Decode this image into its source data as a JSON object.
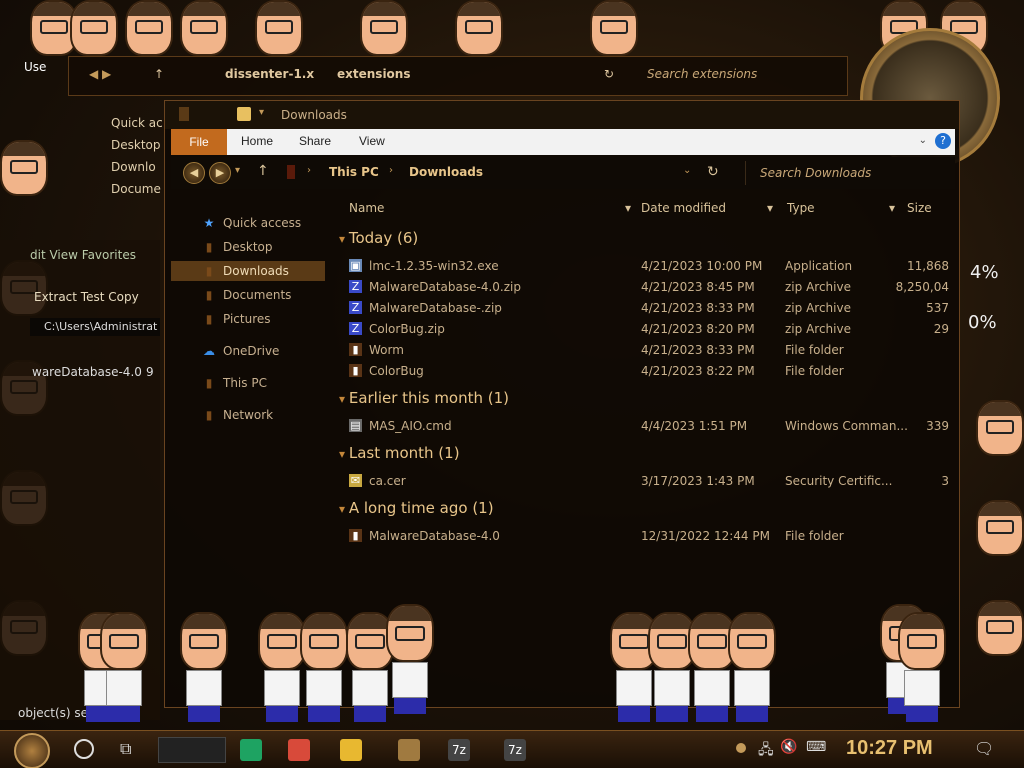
{
  "bg_window": {
    "crumb1": "dissenter-1.x",
    "crumb2": "extensions",
    "search_placeholder": "Search extensions",
    "sidebar": [
      "Quick ac",
      "Desktop",
      "Downlo",
      "Docume"
    ]
  },
  "left_pane": {
    "menu": "dit   View   Favorites",
    "toolbar": "Extract  Test   Copy",
    "address": "C:\\Users\\Administrat",
    "row": "wareDatabase-4.0",
    "row_extra": "9",
    "status": "object(s) sele"
  },
  "overlay_text": {
    "user": "Use",
    "pct1": "4%",
    "pct2": "0%"
  },
  "window": {
    "title": "Downloads",
    "ribbon": {
      "file": "File",
      "home": "Home",
      "share": "Share",
      "view": "View",
      "help": "?"
    },
    "breadcrumb": [
      "This PC",
      "Downloads"
    ],
    "search_placeholder": "Search Downloads"
  },
  "nav": [
    {
      "label": "Quick access",
      "icon": "★",
      "color": "#4fa3ff"
    },
    {
      "label": "Desktop",
      "icon": "▮",
      "color": "#7a4a1a"
    },
    {
      "label": "Downloads",
      "icon": "▮",
      "color": "#7a4a1a"
    },
    {
      "label": "Documents",
      "icon": "▮",
      "color": "#7a4a1a"
    },
    {
      "label": "Pictures",
      "icon": "▮",
      "color": "#7a4a1a"
    },
    {
      "label": "OneDrive",
      "icon": "☁",
      "color": "#3a8ee8"
    },
    {
      "label": "This PC",
      "icon": "▮",
      "color": "#7a4a1a"
    },
    {
      "label": "Network",
      "icon": "▮",
      "color": "#7a4a1a"
    }
  ],
  "columns": {
    "name": "Name",
    "date": "Date modified",
    "type": "Type",
    "size": "Size"
  },
  "groups": [
    {
      "title": "Today (6)",
      "rows": [
        {
          "name": "lmc-1.2.35-win32.exe",
          "date": "4/21/2023 10:00 PM",
          "type": "Application",
          "size": "11,868",
          "icon": "app"
        },
        {
          "name": "MalwareDatabase-4.0.zip",
          "date": "4/21/2023 8:45 PM",
          "type": "zip Archive",
          "size": "8,250,04",
          "icon": "zip"
        },
        {
          "name": "MalwareDatabase-.zip",
          "date": "4/21/2023 8:33 PM",
          "type": "zip Archive",
          "size": "537",
          "icon": "zip"
        },
        {
          "name": "ColorBug.zip",
          "date": "4/21/2023 8:20 PM",
          "type": "zip Archive",
          "size": "29",
          "icon": "zip"
        },
        {
          "name": "Worm",
          "date": "4/21/2023 8:33 PM",
          "type": "File folder",
          "size": "",
          "icon": "folder"
        },
        {
          "name": "ColorBug",
          "date": "4/21/2023 8:22 PM",
          "type": "File folder",
          "size": "",
          "icon": "folder"
        }
      ]
    },
    {
      "title": "Earlier this month (1)",
      "rows": [
        {
          "name": "MAS_AIO.cmd",
          "date": "4/4/2023 1:51 PM",
          "type": "Windows Comman...",
          "size": "339",
          "icon": "cmd"
        }
      ]
    },
    {
      "title": "Last month (1)",
      "rows": [
        {
          "name": "ca.cer",
          "date": "3/17/2023 1:43 PM",
          "type": "Security Certific...",
          "size": "3",
          "icon": "cert"
        }
      ]
    },
    {
      "title": "A long time ago (1)",
      "rows": [
        {
          "name": "MalwareDatabase-4.0",
          "date": "12/31/2022 12:44 PM",
          "type": "File folder",
          "size": "",
          "icon": "folder"
        }
      ]
    }
  ],
  "taskbar": {
    "clock": "10:27 PM",
    "icons": [
      "sheets-icon",
      "chrome-icon",
      "folder-icon",
      "game-icon",
      "7zip-icon",
      "7zip-icon"
    ],
    "labels": [
      "",
      "",
      "",
      "",
      "7z",
      "7z"
    ]
  }
}
